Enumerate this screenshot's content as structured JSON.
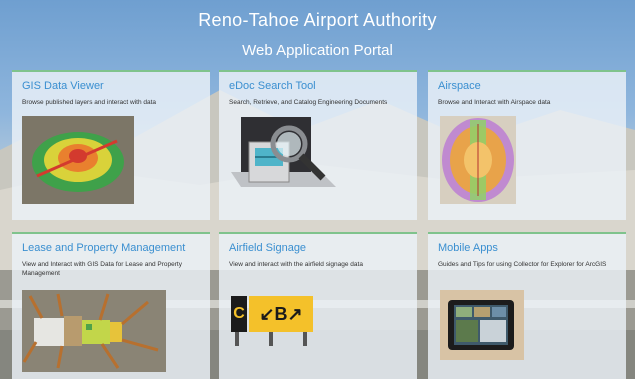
{
  "header": {
    "title": "Reno-Tahoe Airport Authority",
    "subtitle": "Web Application Portal"
  },
  "cards": [
    {
      "title": "GIS Data Viewer",
      "description": "Browse published layers and interact with data",
      "thumb_icon": "gis-heatmap-thumbnail"
    },
    {
      "title": "eDoc Search Tool",
      "description": "Search, Retrieve, and Catalog Engineering Documents",
      "thumb_icon": "document-search-thumbnail"
    },
    {
      "title": "Airspace",
      "description": "Browse and Interact with Airspace data",
      "thumb_icon": "airspace-map-thumbnail"
    },
    {
      "title": "Lease and Property Management",
      "description": "View and Interact with GIS Data for Lease and Property Management",
      "thumb_icon": "property-map-thumbnail"
    },
    {
      "title": "Airfield Signage",
      "description": "View and interact with the airfield signage data",
      "thumb_icon": "airfield-sign-thumbnail"
    },
    {
      "title": "Mobile Apps",
      "description": "Guides and Tips for using Collector for Explorer for ArcGIS",
      "thumb_icon": "tablet-thumbnail"
    }
  ],
  "signage": {
    "left_sign": "C",
    "right_sign": "↙B↗"
  },
  "colors": {
    "card_title": "#3a8fd0",
    "card_accent": "#7fc38c"
  }
}
